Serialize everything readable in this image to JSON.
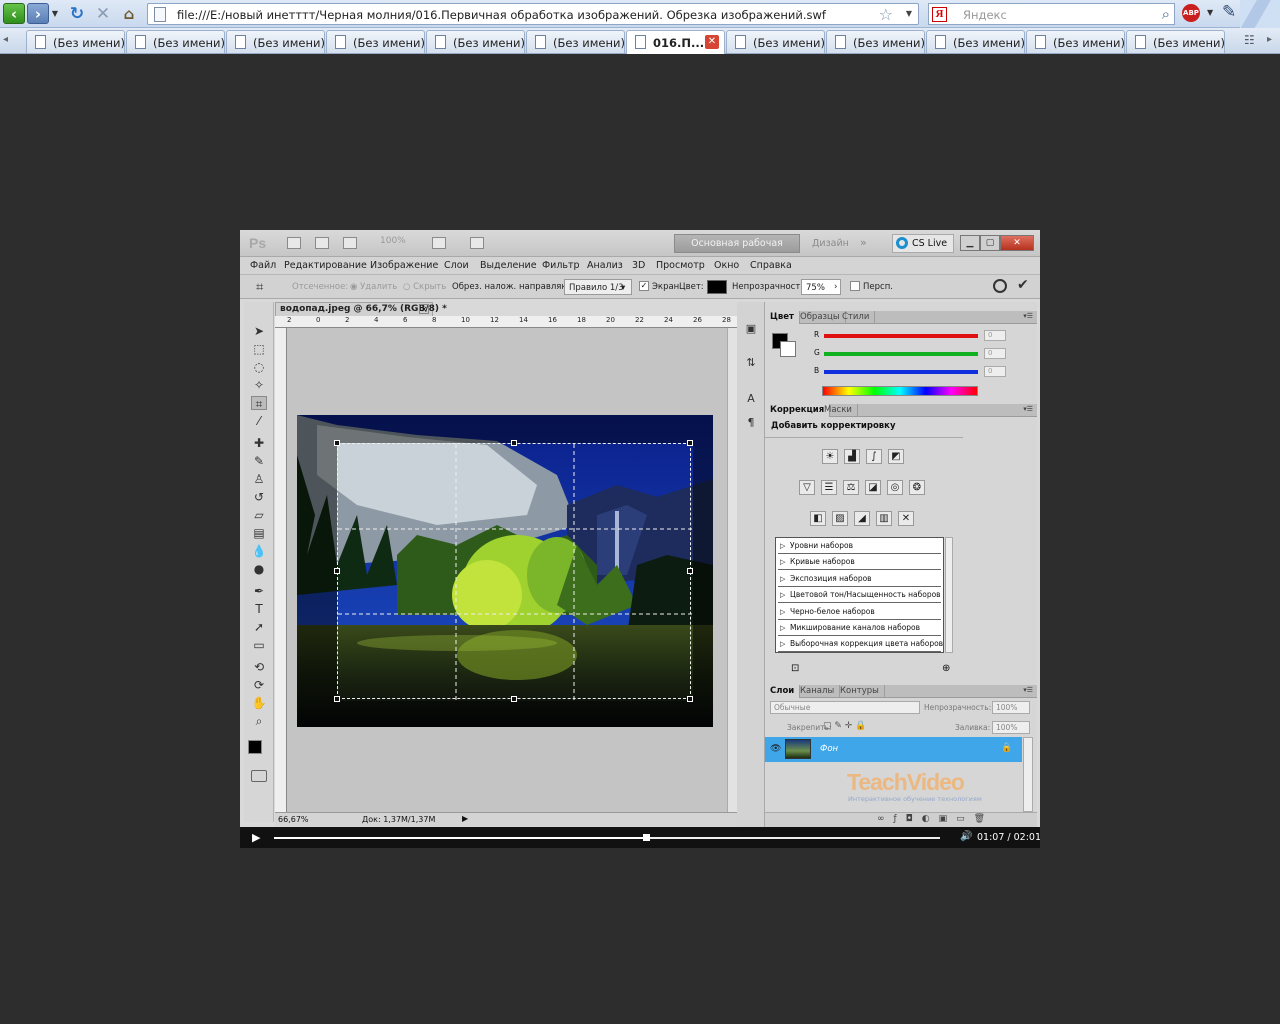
{
  "browser": {
    "url": "file:///E:/новый инетттт/Черная молния/016.Первичная обработка изображений. Обрезка изображений.swf",
    "search_placeholder": "Яндекс",
    "search_engine_badge": "Я",
    "adblock_label": "ABP",
    "tabs": [
      {
        "label": "(Без имени)"
      },
      {
        "label": "(Без имени)"
      },
      {
        "label": "(Без имени)"
      },
      {
        "label": "(Без имени)"
      },
      {
        "label": "(Без имени)"
      },
      {
        "label": "(Без имени)"
      },
      {
        "label": "016.П...",
        "active": true
      },
      {
        "label": "(Без имени)"
      },
      {
        "label": "(Без имени)"
      },
      {
        "label": "(Без имени)"
      },
      {
        "label": "(Без имени)"
      },
      {
        "label": "(Без имени)"
      }
    ]
  },
  "photoshop": {
    "logo": "Ps",
    "zoom_combo": "100%",
    "workspace_active": "Основная рабочая среда",
    "workspace_other": "Дизайн",
    "cs_live": "CS Live",
    "menu": [
      "Файл",
      "Редактирование",
      "Изображение",
      "Слои",
      "Выделение",
      "Фильтр",
      "Анализ",
      "3D",
      "Просмотр",
      "Окно",
      "Справка"
    ],
    "options": {
      "cropped_label": "Отсеченное:",
      "delete_label": "Удалить",
      "hide_label": "Скрыть",
      "guide_label": "Обрез. налож. направляющ.:",
      "guide_value": "Правило 1/3",
      "screen_label": "Экран",
      "color_label": "Цвет:",
      "opacity_label": "Непрозрачность:",
      "opacity_value": "75%",
      "perspective_label": "Персп."
    },
    "document": {
      "title": "водопад.jpeg @ 66,7% (RGB/8) *",
      "ruler_ticks": [
        "2",
        "0",
        "2",
        "4",
        "6",
        "8",
        "10",
        "12",
        "14",
        "16",
        "18",
        "20",
        "22",
        "24",
        "26",
        "28"
      ],
      "zoom_status": "66,67%",
      "doc_status": "Док: 1,37M/1,37M"
    },
    "color_panel": {
      "tabs": [
        "Цвет",
        "Образцы",
        "Стили"
      ],
      "channels": [
        {
          "label": "R",
          "value": "0",
          "color": "#e01010"
        },
        {
          "label": "G",
          "value": "0",
          "color": "#10b020"
        },
        {
          "label": "B",
          "value": "0",
          "color": "#1030e0"
        }
      ]
    },
    "adjustments_panel": {
      "tabs": [
        "Коррекция",
        "Маски"
      ],
      "header": "Добавить корректировку",
      "presets": [
        "Уровни наборов",
        "Кривые наборов",
        "Экспозиция наборов",
        "Цветовой тон/Насыщенность наборов",
        "Черно-белое наборов",
        "Микширование каналов наборов",
        "Выборочная коррекция цвета наборов"
      ]
    },
    "layers_panel": {
      "tabs": [
        "Слои",
        "Каналы",
        "Контуры"
      ],
      "blend_mode": "Обычные",
      "opacity_label": "Непрозрачность:",
      "opacity_value": "100%",
      "lock_label": "Закрепить:",
      "fill_label": "Заливка:",
      "fill_value": "100%",
      "layer_name": "Фон"
    },
    "watermark": "TeachVideo",
    "watermark_sub": "Интерактивное обучение технологиям"
  },
  "player": {
    "time": "01:07 / 02:01",
    "progress": 0.558
  }
}
